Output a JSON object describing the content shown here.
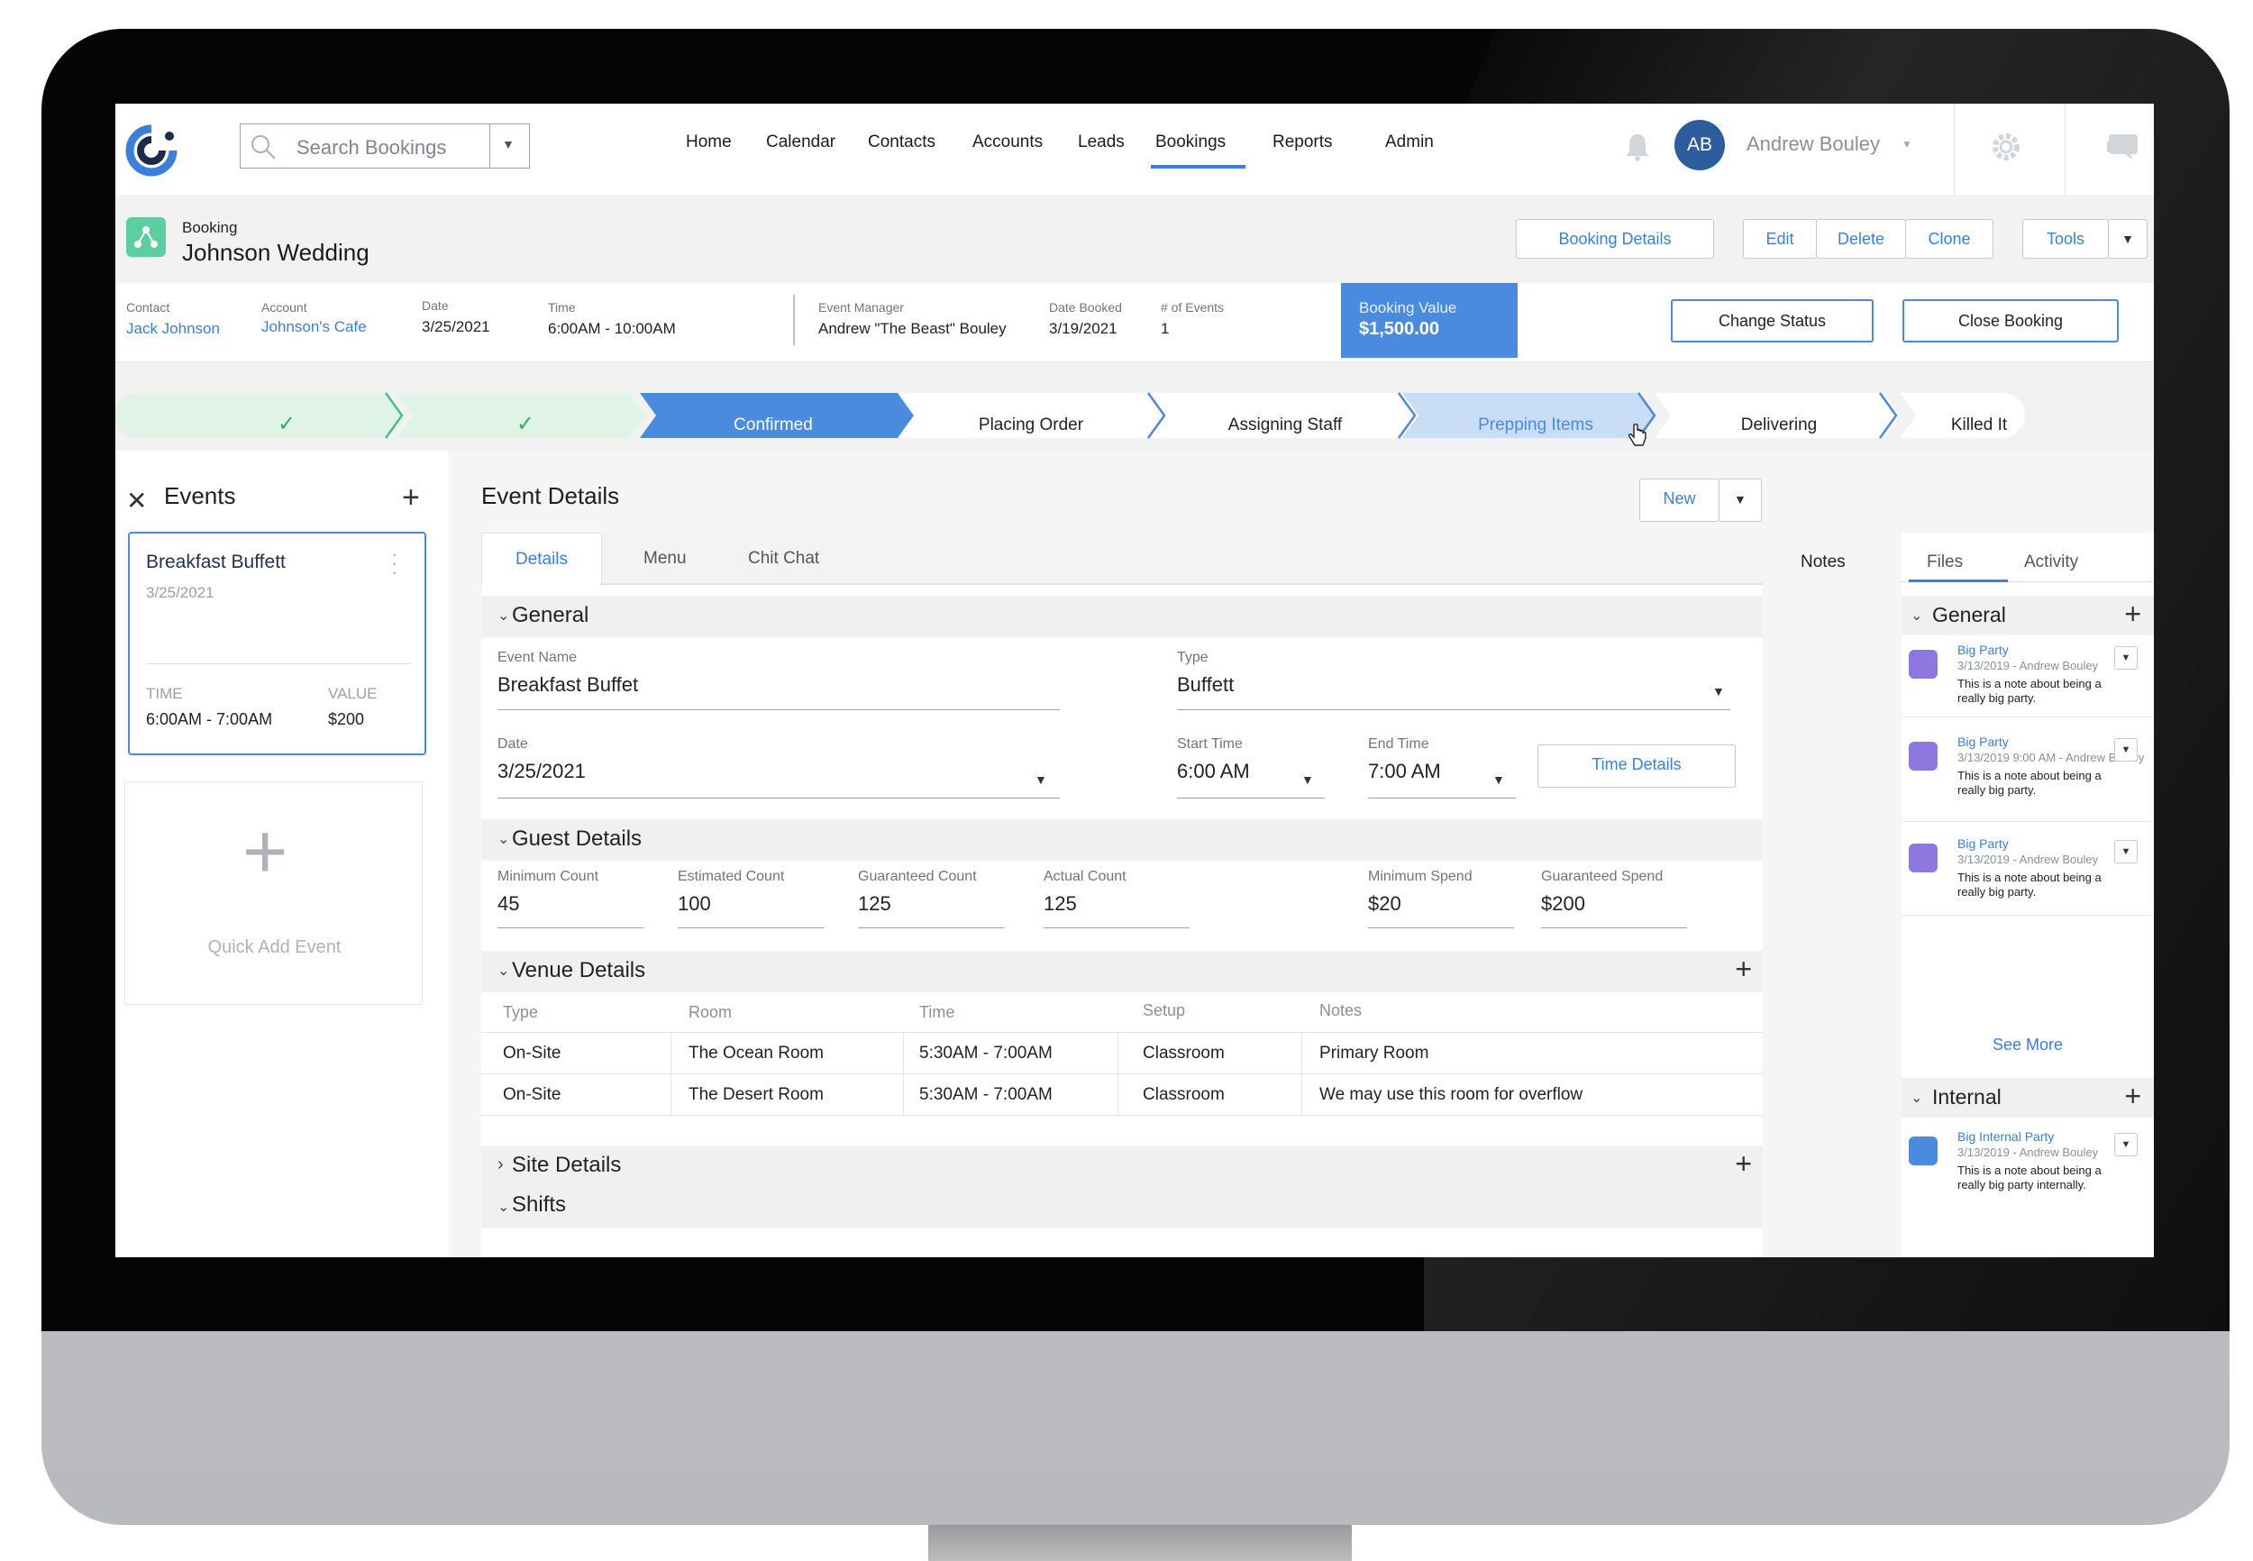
{
  "search": {
    "placeholder": "Search Bookings"
  },
  "nav": {
    "home": "Home",
    "calendar": "Calendar",
    "contacts": "Contacts",
    "accounts": "Accounts",
    "leads": "Leads",
    "bookings": "Bookings",
    "reports": "Reports",
    "admin": "Admin"
  },
  "user": {
    "initials": "AB",
    "name": "Andrew Bouley"
  },
  "record": {
    "type": "Booking",
    "title": "Johnson Wedding"
  },
  "actions": {
    "booking_details": "Booking Details",
    "edit": "Edit",
    "delete": "Delete",
    "clone": "Clone",
    "tools": "Tools",
    "change_status": "Change Status",
    "close_booking": "Close Booking"
  },
  "info": {
    "contact_label": "Contact",
    "contact": "Jack Johnson",
    "account_label": "Account",
    "account": "Johnson's Cafe",
    "date_label": "Date",
    "date": "3/25/2021",
    "time_label": "Time",
    "time": "6:00AM - 10:00AM",
    "manager_label": "Event Manager",
    "manager": "Andrew \"The Beast\" Bouley",
    "booked_label": "Date Booked",
    "booked": "3/19/2021",
    "events_label": "# of Events",
    "events": "1",
    "value_label": "Booking Value",
    "value": "$1,500.00"
  },
  "path": {
    "steps": [
      {
        "label": "✓",
        "state": "complete"
      },
      {
        "label": "✓",
        "state": "complete"
      },
      {
        "label": "Confirmed",
        "state": "current"
      },
      {
        "label": "Placing Order",
        "state": "incomplete"
      },
      {
        "label": "Assigning Staff",
        "state": "incomplete"
      },
      {
        "label": "Prepping Items",
        "state": "hover"
      },
      {
        "label": "Delivering",
        "state": "incomplete"
      },
      {
        "label": "Killed It",
        "state": "incomplete"
      }
    ]
  },
  "events_panel": {
    "title": "Events",
    "card": {
      "title": "Breakfast Buffett",
      "date": "3/25/2021",
      "time_label": "TIME",
      "time": "6:00AM - 7:00AM",
      "value_label": "VALUE",
      "value": "$200"
    },
    "quick_add": "Quick Add Event"
  },
  "event_details": {
    "title": "Event Details",
    "new": "New",
    "tabs": {
      "details": "Details",
      "menu": "Menu",
      "chit_chat": "Chit Chat"
    },
    "general": {
      "section": "General",
      "event_name_label": "Event Name",
      "event_name": "Breakfast Buffet",
      "type_label": "Type",
      "type": "Buffett",
      "date_label": "Date",
      "date": "3/25/2021",
      "start_label": "Start Time",
      "start": "6:00 AM",
      "end_label": "End Time",
      "end": "7:00 AM",
      "time_details": "Time Details"
    },
    "guest": {
      "section": "Guest Details",
      "min_label": "Minimum Count",
      "min": "45",
      "est_label": "Estimated Count",
      "est": "100",
      "guar_label": "Guaranteed Count",
      "guar": "125",
      "actual_label": "Actual Count",
      "actual": "125",
      "min_spend_label": "Minimum Spend",
      "min_spend": "$20",
      "guar_spend_label": "Guaranteed Spend",
      "guar_spend": "$200"
    },
    "venue": {
      "section": "Venue Details",
      "headers": {
        "type": "Type",
        "room": "Room",
        "time": "Time",
        "setup": "Setup",
        "notes": "Notes"
      },
      "rows": [
        {
          "type": "On-Site",
          "room": "The Ocean Room",
          "time": "5:30AM - 7:00AM",
          "setup": "Classroom",
          "notes": "Primary Room"
        },
        {
          "type": "On-Site",
          "room": "The Desert Room",
          "time": "5:30AM - 7:00AM",
          "setup": "Classroom",
          "notes": "We may use this room for overflow"
        }
      ]
    },
    "site": {
      "section": "Site Details"
    },
    "shifts": {
      "section": "Shifts"
    }
  },
  "notes_panel": {
    "tabs": {
      "notes": "Notes",
      "files": "Files",
      "activity": "Activity"
    },
    "general": "General",
    "internal": "Internal",
    "see_more": "See More",
    "general_notes": [
      {
        "title": "Big Party",
        "meta": "3/13/2019 - Andrew Bouley",
        "body": "This is a note about being a really big party."
      },
      {
        "title": "Big Party",
        "meta": "3/13/2019 9:00 AM - Andrew Bouley",
        "body": "This is a note about being a really big party."
      },
      {
        "title": "Big Party",
        "meta": "3/13/2019 - Andrew Bouley",
        "body": "This is a note about being a really big party."
      }
    ],
    "internal_notes": [
      {
        "title": "Big Internal Party",
        "meta": "3/13/2019 - Andrew Bouley",
        "body": "This is a note about being a really big party internally."
      }
    ]
  }
}
